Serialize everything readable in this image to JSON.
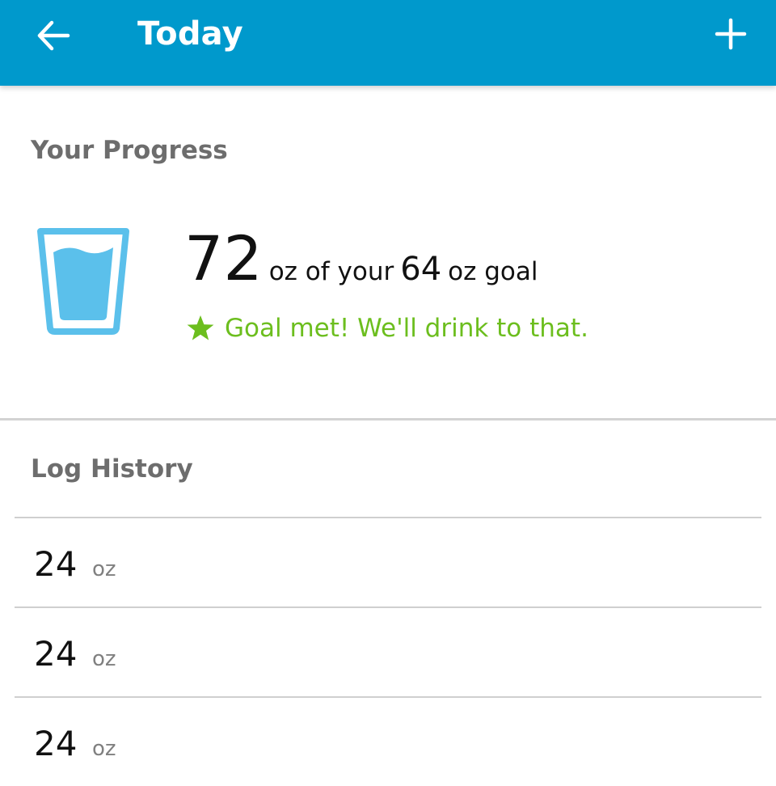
{
  "appbar": {
    "title": "Today",
    "back_icon": "arrow-left-icon",
    "add_icon": "plus-icon",
    "color": "#0099cc"
  },
  "progress": {
    "heading": "Your Progress",
    "icon": "water-glass-icon",
    "amount": "72",
    "middle_text": "oz of your",
    "goal": "64",
    "goal_unit": "oz goal",
    "goal_message": "Goal met! We'll drink to that.",
    "goal_message_icon": "star-icon",
    "accent": "#5bc0eb",
    "success": "#6cbe1e"
  },
  "log_history": {
    "heading": "Log History",
    "entries": [
      {
        "amount": "24",
        "unit": "oz"
      },
      {
        "amount": "24",
        "unit": "oz"
      },
      {
        "amount": "24",
        "unit": "oz"
      }
    ]
  }
}
